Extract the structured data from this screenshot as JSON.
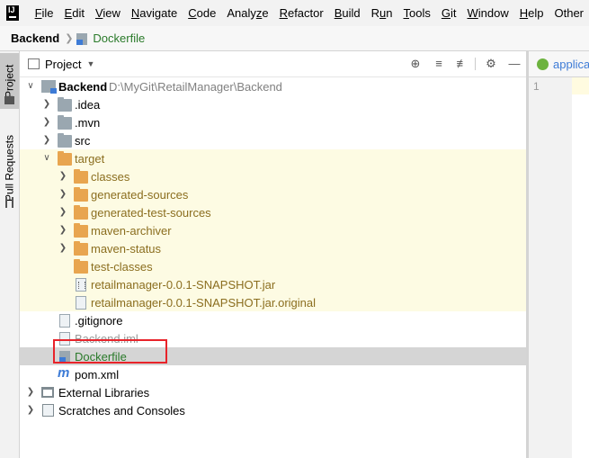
{
  "menu": [
    "File",
    "Edit",
    "View",
    "Navigate",
    "Code",
    "Analyze",
    "Refactor",
    "Build",
    "Run",
    "Tools",
    "Git",
    "Window",
    "Help",
    "Other"
  ],
  "menu_mnemonic": [
    "F",
    "E",
    "V",
    "N",
    "C",
    "z",
    "R",
    "B",
    "u",
    "T",
    "G",
    "W",
    "H",
    ""
  ],
  "app_logo": "IJ",
  "breadcrumb": {
    "root": "Backend",
    "file": "Dockerfile"
  },
  "sidebar_tabs": {
    "project": "Project",
    "pull_requests": "Pull Requests"
  },
  "project_panel": {
    "title": "Project",
    "header_icons": [
      "locate-icon",
      "expand-all-icon",
      "collapse-all-icon",
      "gear-icon",
      "hide-icon"
    ]
  },
  "tree": {
    "root": {
      "label": "Backend",
      "path": "D:\\MyGit\\RetailManager\\Backend"
    },
    "idea": ".idea",
    "mvn": ".mvn",
    "src": "src",
    "target": "target",
    "classes": "classes",
    "generated_sources": "generated-sources",
    "generated_test_sources": "generated-test-sources",
    "maven_archiver": "maven-archiver",
    "maven_status": "maven-status",
    "test_classes": "test-classes",
    "jar": "retailmanager-0.0.1-SNAPSHOT.jar",
    "jar_original": "retailmanager-0.0.1-SNAPSHOT.jar.original",
    "gitignore": ".gitignore",
    "backend_iml": "Backend.iml",
    "dockerfile": "Dockerfile",
    "pom": "pom.xml",
    "external_libraries": "External Libraries",
    "scratches": "Scratches and Consoles"
  },
  "editor": {
    "tab_label": "applica",
    "line_number": "1"
  },
  "colors": {
    "highlight_row": "#fdfbe3",
    "selected_row": "#d5d5d5",
    "annotation_box": "#e8232a",
    "vcs_added": "#2a7a2a"
  }
}
